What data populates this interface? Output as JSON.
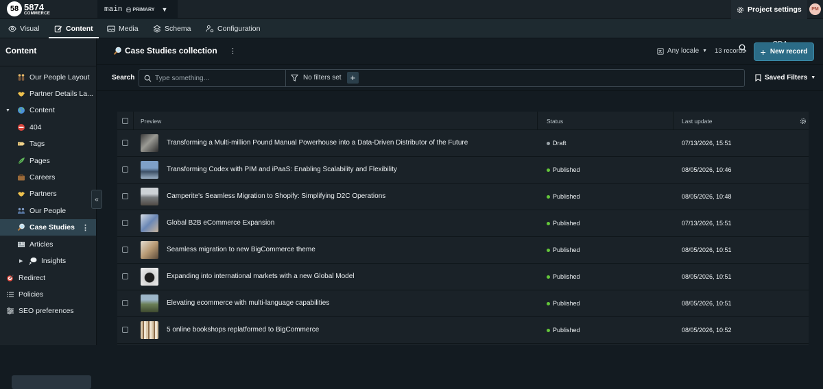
{
  "brand": {
    "badge": "58",
    "name": "5874",
    "sub": "COMMERCE"
  },
  "branch": {
    "name": "main",
    "tag": "PRIMARY"
  },
  "top": {
    "project_settings": "Project settings",
    "avatar_initials": "PM"
  },
  "tabs": [
    {
      "label": "Visual",
      "icon": "eye-icon"
    },
    {
      "label": "Content",
      "icon": "edit-icon",
      "active": true
    },
    {
      "label": "Media",
      "icon": "image-icon"
    },
    {
      "label": "Schema",
      "icon": "layers-icon"
    },
    {
      "label": "Configuration",
      "icon": "settings-person-icon"
    }
  ],
  "cda": "CDA Playground",
  "sidebar": {
    "title": "Content",
    "items": [
      {
        "label": "Our People Layout",
        "icon": "people-emoji-icon"
      },
      {
        "label": "Partner Details La...",
        "icon": "handshake-emoji-icon"
      },
      {
        "label": "Content",
        "icon": "globe-icon"
      },
      {
        "label": "404",
        "icon": "no-entry-icon"
      },
      {
        "label": "Tags",
        "icon": "tag-icon"
      },
      {
        "label": "Pages",
        "icon": "pages-icon"
      },
      {
        "label": "Careers",
        "icon": "briefcase-icon"
      },
      {
        "label": "Partners",
        "icon": "handshake-icon"
      },
      {
        "label": "Our People",
        "icon": "people-icon"
      },
      {
        "label": "Case Studies",
        "icon": "magnifier-icon",
        "active": true
      },
      {
        "label": "Articles",
        "icon": "newspaper-icon"
      },
      {
        "label": "Insights",
        "icon": "thought-bubble-icon"
      },
      {
        "label": "Redirect",
        "icon": "target-icon"
      },
      {
        "label": "Policies",
        "icon": "list-icon"
      },
      {
        "label": "SEO preferences",
        "icon": "sliders-icon"
      }
    ]
  },
  "header": {
    "title": "Case Studies collection",
    "locale": "Any locale",
    "records": "13 records",
    "new_record": "New record"
  },
  "filters": {
    "search_label": "Search",
    "placeholder": "Type something...",
    "no_filters": "No filters set",
    "saved_filters": "Saved Filters"
  },
  "table": {
    "columns": {
      "preview": "Preview",
      "status": "Status",
      "last_update": "Last update"
    },
    "rows": [
      {
        "title": "Transforming a Multi-million Pound Manual Powerhouse into a Data-Driven Distributor of the Future",
        "status": "Draft",
        "date": "07/13/2026, 15:51"
      },
      {
        "title": "Transforming Codex with PIM and iPaaS: Enabling Scalability and Flexibility",
        "status": "Published",
        "date": "08/05/2026, 10:46"
      },
      {
        "title": "Camperite's Seamless Migration to Shopify: Simplifying D2C Operations",
        "status": "Published",
        "date": "08/05/2026, 10:48"
      },
      {
        "title": "Global B2B eCommerce Expansion",
        "status": "Published",
        "date": "07/13/2026, 15:51"
      },
      {
        "title": "Seamless migration to new BigCommerce theme",
        "status": "Published",
        "date": "08/05/2026, 10:51"
      },
      {
        "title": "Expanding into international markets with a new Global Model",
        "status": "Published",
        "date": "08/05/2026, 10:51"
      },
      {
        "title": "Elevating ecommerce with multi-language capabilities",
        "status": "Published",
        "date": "08/05/2026, 10:51"
      },
      {
        "title": "5 online bookshops replatformed to BigCommerce",
        "status": "Published",
        "date": "08/05/2026, 10:52"
      }
    ]
  },
  "colors": {
    "published": "#64c63a",
    "draft": "#9aa3a8",
    "accent": "#2b6b86"
  }
}
